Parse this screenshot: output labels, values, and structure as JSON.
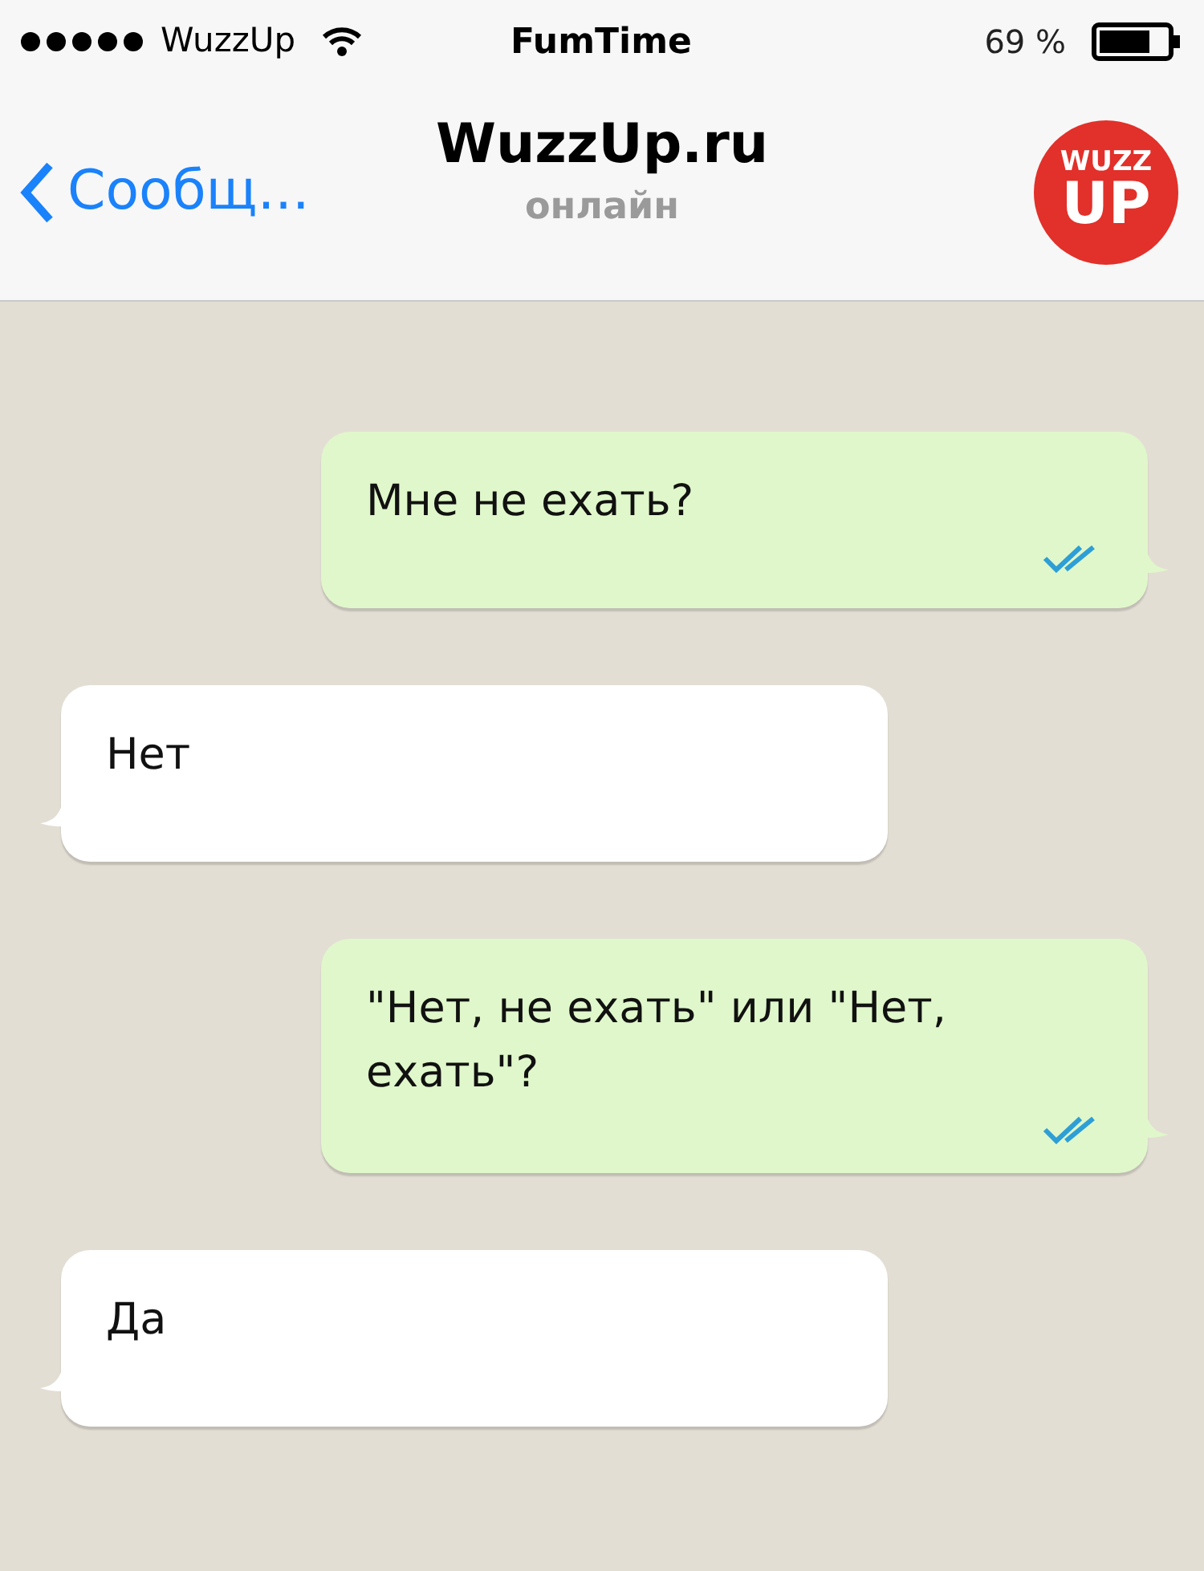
{
  "status_bar": {
    "carrier": "WuzzUp",
    "time": "FumTime",
    "battery": "69 %"
  },
  "header": {
    "back": "Сообщ...",
    "title": "WuzzUp.ru",
    "subtitle": "онлайн",
    "logo": [
      "WUZZ",
      "UP"
    ]
  },
  "messages": [
    {
      "kind": "outgoing",
      "text": "Мне не ехать?",
      "read": true
    },
    {
      "kind": "incoming",
      "text": "Нет"
    },
    {
      "kind": "outgoing",
      "text": "\"Нет, не ехать\" или \"Нет, ехать\"?",
      "read": true
    },
    {
      "kind": "incoming",
      "text": "Да"
    }
  ]
}
